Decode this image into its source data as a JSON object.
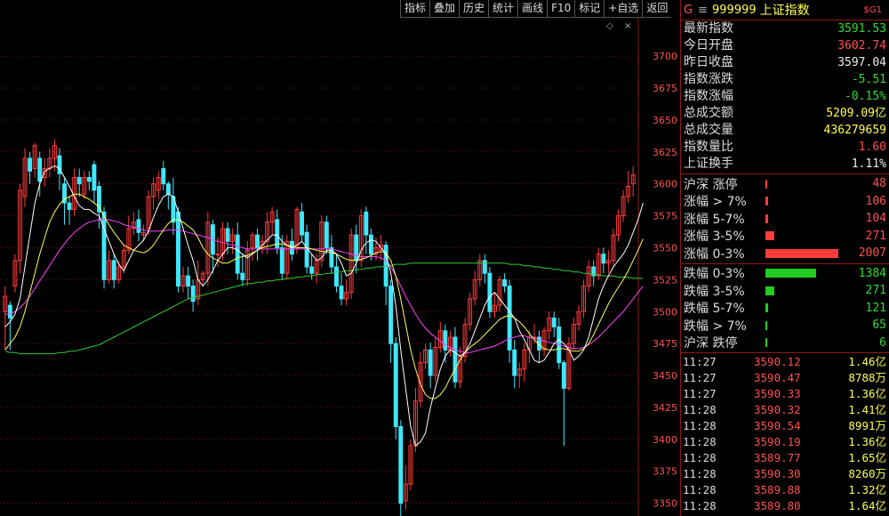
{
  "toolbar": [
    "指标",
    "叠加",
    "历史",
    "统计",
    "画线",
    "F10",
    "标记",
    "+自选",
    "返回"
  ],
  "chart_icons": {
    "diamond": "◇",
    "close": "×"
  },
  "colors": {
    "up": "#ff3c3c",
    "down": "#3ee8ff",
    "ma5": "#ffffff",
    "ma10": "#ffff55",
    "ma20": "#ff44ff",
    "ma60": "#33cc33",
    "grid": "#7a1010"
  },
  "chart_data": {
    "type": "candlestick",
    "y_ticks": [
      3350,
      3375,
      3400,
      3425,
      3450,
      3475,
      3500,
      3525,
      3550,
      3575,
      3600,
      3625,
      3650,
      3675,
      3700
    ],
    "ylim": [
      3340,
      3730
    ],
    "candles": [
      [
        3500,
        3512,
        3470,
        3520
      ],
      [
        3505,
        3495,
        3470,
        3508
      ],
      [
        3520,
        3540,
        3515,
        3545
      ],
      [
        3540,
        3595,
        3530,
        3600
      ],
      [
        3590,
        3620,
        3582,
        3628
      ],
      [
        3620,
        3610,
        3600,
        3625
      ],
      [
        3612,
        3630,
        3605,
        3632
      ],
      [
        3620,
        3602,
        3590,
        3625
      ],
      [
        3605,
        3612,
        3598,
        3620
      ],
      [
        3612,
        3620,
        3605,
        3628
      ],
      [
        3620,
        3630,
        3610,
        3635
      ],
      [
        3622,
        3608,
        3595,
        3628
      ],
      [
        3600,
        3585,
        3568,
        3605
      ],
      [
        3585,
        3580,
        3568,
        3590
      ],
      [
        3580,
        3605,
        3575,
        3612
      ],
      [
        3605,
        3600,
        3590,
        3612
      ],
      [
        3592,
        3605,
        3588,
        3610
      ],
      [
        3605,
        3602,
        3595,
        3610
      ],
      [
        3615,
        3595,
        3585,
        3618
      ],
      [
        3598,
        3578,
        3565,
        3602
      ],
      [
        3578,
        3525,
        3518,
        3582
      ],
      [
        3525,
        3540,
        3522,
        3548
      ],
      [
        3540,
        3525,
        3518,
        3545
      ],
      [
        3525,
        3535,
        3522,
        3540
      ],
      [
        3535,
        3548,
        3530,
        3552
      ],
      [
        3548,
        3565,
        3545,
        3575
      ],
      [
        3565,
        3570,
        3560,
        3578
      ],
      [
        3572,
        3562,
        3555,
        3580
      ],
      [
        3560,
        3562,
        3555,
        3568
      ],
      [
        3565,
        3590,
        3560,
        3595
      ],
      [
        3590,
        3600,
        3580,
        3605
      ],
      [
        3595,
        3605,
        3588,
        3610
      ],
      [
        3612,
        3600,
        3595,
        3618
      ],
      [
        3600,
        3592,
        3580,
        3602
      ],
      [
        3590,
        3570,
        3560,
        3605
      ],
      [
        3578,
        3520,
        3515,
        3582
      ],
      [
        3520,
        3528,
        3515,
        3535
      ],
      [
        3528,
        3520,
        3510,
        3535
      ],
      [
        3520,
        3508,
        3500,
        3525
      ],
      [
        3510,
        3525,
        3505,
        3540
      ],
      [
        3525,
        3530,
        3520,
        3532
      ],
      [
        3530,
        3570,
        3520,
        3578
      ],
      [
        3568,
        3545,
        3530,
        3572
      ],
      [
        3545,
        3545,
        3535,
        3558
      ],
      [
        3545,
        3565,
        3540,
        3570
      ],
      [
        3565,
        3555,
        3545,
        3570
      ],
      [
        3555,
        3560,
        3545,
        3565
      ],
      [
        3560,
        3530,
        3525,
        3570
      ],
      [
        3530,
        3525,
        3520,
        3545
      ],
      [
        3525,
        3548,
        3520,
        3555
      ],
      [
        3550,
        3560,
        3540,
        3562
      ],
      [
        3560,
        3550,
        3540,
        3565
      ],
      [
        3550,
        3555,
        3545,
        3560
      ],
      [
        3555,
        3570,
        3545,
        3578
      ],
      [
        3570,
        3578,
        3560,
        3582
      ],
      [
        3572,
        3550,
        3545,
        3580
      ],
      [
        3550,
        3530,
        3525,
        3560
      ],
      [
        3530,
        3555,
        3525,
        3560
      ],
      [
        3555,
        3545,
        3540,
        3565
      ],
      [
        3550,
        3580,
        3545,
        3582
      ],
      [
        3578,
        3560,
        3555,
        3585
      ],
      [
        3562,
        3535,
        3530,
        3568
      ],
      [
        3535,
        3530,
        3525,
        3545
      ],
      [
        3530,
        3540,
        3522,
        3545
      ],
      [
        3540,
        3570,
        3535,
        3575
      ],
      [
        3570,
        3550,
        3545,
        3575
      ],
      [
        3550,
        3535,
        3530,
        3560
      ],
      [
        3535,
        3520,
        3515,
        3545
      ],
      [
        3520,
        3510,
        3505,
        3530
      ],
      [
        3510,
        3515,
        3505,
        3525
      ],
      [
        3515,
        3560,
        3510,
        3565
      ],
      [
        3560,
        3540,
        3530,
        3568
      ],
      [
        3540,
        3575,
        3535,
        3580
      ],
      [
        3578,
        3560,
        3545,
        3582
      ],
      [
        3560,
        3545,
        3540,
        3565
      ],
      [
        3545,
        3550,
        3540,
        3558
      ],
      [
        3548,
        3552,
        3540,
        3560
      ],
      [
        3552,
        3520,
        3505,
        3555
      ],
      [
        3520,
        3475,
        3460,
        3525
      ],
      [
        3475,
        3410,
        3400,
        3480
      ],
      [
        3410,
        3350,
        3340,
        3415
      ],
      [
        3352,
        3365,
        3345,
        3380
      ],
      [
        3365,
        3395,
        3360,
        3400
      ],
      [
        3395,
        3430,
        3390,
        3440
      ],
      [
        3430,
        3460,
        3425,
        3468
      ],
      [
        3460,
        3470,
        3455,
        3475
      ],
      [
        3470,
        3450,
        3440,
        3476
      ],
      [
        3450,
        3472,
        3445,
        3480
      ],
      [
        3472,
        3485,
        3468,
        3492
      ],
      [
        3485,
        3470,
        3460,
        3490
      ],
      [
        3470,
        3480,
        3465,
        3485
      ],
      [
        3480,
        3445,
        3440,
        3488
      ],
      [
        3445,
        3465,
        3440,
        3472
      ],
      [
        3465,
        3490,
        3460,
        3495
      ],
      [
        3490,
        3510,
        3485,
        3515
      ],
      [
        3510,
        3525,
        3505,
        3532
      ],
      [
        3525,
        3540,
        3520,
        3545
      ],
      [
        3540,
        3530,
        3522,
        3545
      ],
      [
        3530,
        3500,
        3495,
        3535
      ],
      [
        3500,
        3505,
        3495,
        3515
      ],
      [
        3505,
        3525,
        3500,
        3528
      ],
      [
        3525,
        3520,
        3515,
        3530
      ],
      [
        3520,
        3470,
        3460,
        3525
      ],
      [
        3470,
        3450,
        3440,
        3478
      ],
      [
        3450,
        3455,
        3440,
        3460
      ],
      [
        3455,
        3470,
        3445,
        3475
      ],
      [
        3470,
        3480,
        3460,
        3485
      ],
      [
        3480,
        3480,
        3475,
        3490
      ],
      [
        3480,
        3470,
        3460,
        3485
      ],
      [
        3470,
        3485,
        3465,
        3488
      ],
      [
        3485,
        3495,
        3478,
        3500
      ],
      [
        3495,
        3488,
        3480,
        3500
      ],
      [
        3488,
        3460,
        3455,
        3495
      ],
      [
        3460,
        3440,
        3395,
        3462
      ],
      [
        3440,
        3475,
        3438,
        3480
      ],
      [
        3475,
        3490,
        3470,
        3495
      ],
      [
        3490,
        3500,
        3485,
        3505
      ],
      [
        3500,
        3520,
        3495,
        3525
      ],
      [
        3520,
        3535,
        3515,
        3540
      ],
      [
        3535,
        3528,
        3520,
        3540
      ],
      [
        3528,
        3545,
        3525,
        3550
      ],
      [
        3545,
        3538,
        3530,
        3550
      ],
      [
        3538,
        3540,
        3530,
        3548
      ],
      [
        3540,
        3560,
        3535,
        3565
      ],
      [
        3560,
        3575,
        3555,
        3580
      ],
      [
        3575,
        3590,
        3570,
        3595
      ],
      [
        3590,
        3598,
        3585,
        3610
      ],
      [
        3600,
        3607,
        3590,
        3614
      ]
    ],
    "ma5": [
      3488,
      3492,
      3498,
      3510,
      3535,
      3560,
      3585,
      3600,
      3610,
      3612,
      3614,
      3612,
      3605,
      3598,
      3590,
      3583,
      3580,
      3580,
      3577,
      3575,
      3565,
      3555,
      3545,
      3537,
      3532,
      3540,
      3548,
      3552,
      3556,
      3563,
      3574,
      3583,
      3590,
      3592,
      3590,
      3578,
      3565,
      3552,
      3540,
      3525,
      3520,
      3525,
      3532,
      3540,
      3545,
      3550,
      3550,
      3548,
      3545,
      3542,
      3545,
      3548,
      3552,
      3556,
      3560,
      3560,
      3555,
      3552,
      3550,
      3552,
      3555,
      3550,
      3545,
      3540,
      3542,
      3548,
      3548,
      3545,
      3538,
      3528,
      3530,
      3538,
      3548,
      3554,
      3556,
      3555,
      3550,
      3545,
      3530,
      3505,
      3470,
      3440,
      3410,
      3395,
      3398,
      3405,
      3425,
      3440,
      3455,
      3465,
      3470,
      3468,
      3465,
      3468,
      3475,
      3485,
      3495,
      3505,
      3512,
      3515,
      3510,
      3505,
      3500,
      3495,
      3485,
      3478,
      3470,
      3462,
      3460,
      3462,
      3468,
      3475,
      3478,
      3475,
      3470,
      3462,
      3465,
      3470,
      3480,
      3495,
      3510,
      3520,
      3528,
      3535,
      3540,
      3545,
      3552,
      3562,
      3572,
      3585
    ],
    "ma10": [
      3470,
      3475,
      3480,
      3488,
      3500,
      3515,
      3530,
      3545,
      3558,
      3570,
      3578,
      3584,
      3588,
      3590,
      3592,
      3592,
      3590,
      3588,
      3585,
      3582,
      3575,
      3568,
      3562,
      3557,
      3552,
      3550,
      3548,
      3547,
      3546,
      3548,
      3552,
      3558,
      3564,
      3569,
      3572,
      3572,
      3570,
      3567,
      3564,
      3558,
      3550,
      3545,
      3542,
      3540,
      3538,
      3538,
      3540,
      3542,
      3543,
      3544,
      3546,
      3548,
      3550,
      3551,
      3552,
      3553,
      3553,
      3552,
      3551,
      3550,
      3550,
      3550,
      3549,
      3548,
      3547,
      3547,
      3546,
      3545,
      3543,
      3541,
      3540,
      3540,
      3541,
      3542,
      3544,
      3546,
      3547,
      3546,
      3540,
      3528,
      3510,
      3490,
      3470,
      3455,
      3443,
      3435,
      3432,
      3432,
      3435,
      3440,
      3448,
      3455,
      3462,
      3468,
      3472,
      3475,
      3478,
      3482,
      3486,
      3490,
      3494,
      3496,
      3497,
      3495,
      3492,
      3488,
      3483,
      3478,
      3474,
      3471,
      3470,
      3470,
      3471,
      3471,
      3470,
      3469,
      3469,
      3471,
      3475,
      3482,
      3490,
      3498,
      3506,
      3513,
      3519,
      3525,
      3532,
      3540,
      3548,
      3557
    ],
    "ma20": [
      3498,
      3498,
      3500,
      3503,
      3507,
      3512,
      3518,
      3524,
      3530,
      3536,
      3542,
      3548,
      3553,
      3558,
      3562,
      3565,
      3568,
      3570,
      3571,
      3572,
      3572,
      3572,
      3571,
      3570,
      3568,
      3567,
      3566,
      3565,
      3564,
      3563,
      3563,
      3563,
      3563,
      3564,
      3564,
      3564,
      3563,
      3562,
      3561,
      3560,
      3559,
      3558,
      3556,
      3555,
      3554,
      3553,
      3552,
      3551,
      3550,
      3549,
      3549,
      3549,
      3549,
      3549,
      3549,
      3549,
      3549,
      3549,
      3549,
      3549,
      3549,
      3549,
      3549,
      3549,
      3549,
      3549,
      3549,
      3548,
      3547,
      3546,
      3545,
      3544,
      3543,
      3543,
      3543,
      3543,
      3542,
      3540,
      3535,
      3528,
      3520,
      3512,
      3505,
      3498,
      3492,
      3487,
      3483,
      3480,
      3477,
      3474,
      3472,
      3470,
      3469,
      3468,
      3468,
      3469,
      3470,
      3471,
      3472,
      3473,
      3475,
      3477,
      3479,
      3480,
      3481,
      3481,
      3480,
      3479,
      3478,
      3477,
      3476,
      3475,
      3474,
      3473,
      3472,
      3471,
      3471,
      3472,
      3474,
      3477,
      3480,
      3484,
      3488,
      3492,
      3496,
      3500,
      3505,
      3510,
      3515,
      3520
    ],
    "ma60": [
      3469,
      3468,
      3468,
      3467,
      3467,
      3467,
      3467,
      3467,
      3467,
      3467,
      3467,
      3468,
      3468,
      3469,
      3469,
      3470,
      3471,
      3472,
      3473,
      3474,
      3476,
      3478,
      3480,
      3482,
      3484,
      3486,
      3488,
      3490,
      3492,
      3494,
      3496,
      3498,
      3500,
      3502,
      3504,
      3506,
      3508,
      3510,
      3511,
      3512,
      3513,
      3514,
      3515,
      3516,
      3517,
      3518,
      3519,
      3520,
      3521,
      3522,
      3522,
      3523,
      3523,
      3524,
      3524,
      3525,
      3525,
      3526,
      3526,
      3527,
      3527,
      3528,
      3528,
      3529,
      3529,
      3530,
      3530,
      3531,
      3531,
      3532,
      3532,
      3533,
      3533,
      3534,
      3534,
      3535,
      3535,
      3536,
      3536,
      3537,
      3537,
      3537,
      3538,
      3538,
      3538,
      3538,
      3538,
      3538,
      3538,
      3538,
      3538,
      3538,
      3538,
      3538,
      3538,
      3538,
      3538,
      3538,
      3538,
      3538,
      3538,
      3538,
      3537,
      3537,
      3537,
      3536,
      3536,
      3535,
      3535,
      3534,
      3534,
      3533,
      3533,
      3532,
      3532,
      3531,
      3531,
      3530,
      3530,
      3529,
      3529,
      3528,
      3528,
      3528,
      3527,
      3527,
      3527,
      3526,
      3526,
      3526
    ]
  },
  "panel": {
    "header": {
      "g": "G",
      "menu": "≡",
      "code": "999999",
      "name": "上证指数",
      "badge": "$G1"
    },
    "stats": [
      {
        "k": "最新指数",
        "v": "3591.53",
        "c": "green"
      },
      {
        "k": "今日开盘",
        "v": "3602.74",
        "c": "red"
      },
      {
        "k": "昨日收盘",
        "v": "3597.04",
        "c": "white"
      },
      {
        "k": "指数涨跌",
        "v": "-5.51",
        "c": "green"
      },
      {
        "k": "指数涨幅",
        "v": "-0.15%",
        "c": "green"
      },
      {
        "k": "总成交额",
        "v": "5209.09亿",
        "c": "yellow"
      },
      {
        "k": "总成交量",
        "v": "436279659",
        "c": "yellow"
      },
      {
        "k": "指数量比",
        "v": "1.60",
        "c": "red"
      },
      {
        "k": "上证换手",
        "v": "1.11%",
        "c": "white"
      }
    ],
    "breadth_up": [
      {
        "label": "沪深 涨停",
        "value": "48",
        "ratio": 0.003
      },
      {
        "label": "涨幅 > 7%",
        "value": "106",
        "ratio": 0.04
      },
      {
        "label": "涨幅 5-7%",
        "value": "104",
        "ratio": 0.04
      },
      {
        "label": "涨幅 3-5%",
        "value": "271",
        "ratio": 0.12
      },
      {
        "label": "涨幅 0-3%",
        "value": "2007",
        "ratio": 1.0
      }
    ],
    "breadth_down": [
      {
        "label": "跌幅 0-3%",
        "value": "1384",
        "ratio": 0.69
      },
      {
        "label": "跌幅 3-5%",
        "value": "271",
        "ratio": 0.12
      },
      {
        "label": "跌幅 5-7%",
        "value": "121",
        "ratio": 0.04
      },
      {
        "label": "跌幅 > 7%",
        "value": "65",
        "ratio": 0.02
      },
      {
        "label": "沪深 跌停",
        "value": "6",
        "ratio": 0.003
      }
    ],
    "ticks": [
      {
        "t": "11:27",
        "p": "3590.12",
        "q": "1.46亿"
      },
      {
        "t": "11:27",
        "p": "3590.47",
        "q": "8788万"
      },
      {
        "t": "11:27",
        "p": "3590.33",
        "q": "1.36亿"
      },
      {
        "t": "11:28",
        "p": "3590.32",
        "q": "1.41亿"
      },
      {
        "t": "11:28",
        "p": "3590.54",
        "q": "8991万"
      },
      {
        "t": "11:28",
        "p": "3590.19",
        "q": "1.36亿"
      },
      {
        "t": "11:28",
        "p": "3589.77",
        "q": "1.65亿"
      },
      {
        "t": "11:28",
        "p": "3590.30",
        "q": "8260万"
      },
      {
        "t": "11:28",
        "p": "3589.88",
        "q": "1.32亿"
      },
      {
        "t": "11:28",
        "p": "3589.80",
        "q": "1.64亿"
      }
    ]
  }
}
